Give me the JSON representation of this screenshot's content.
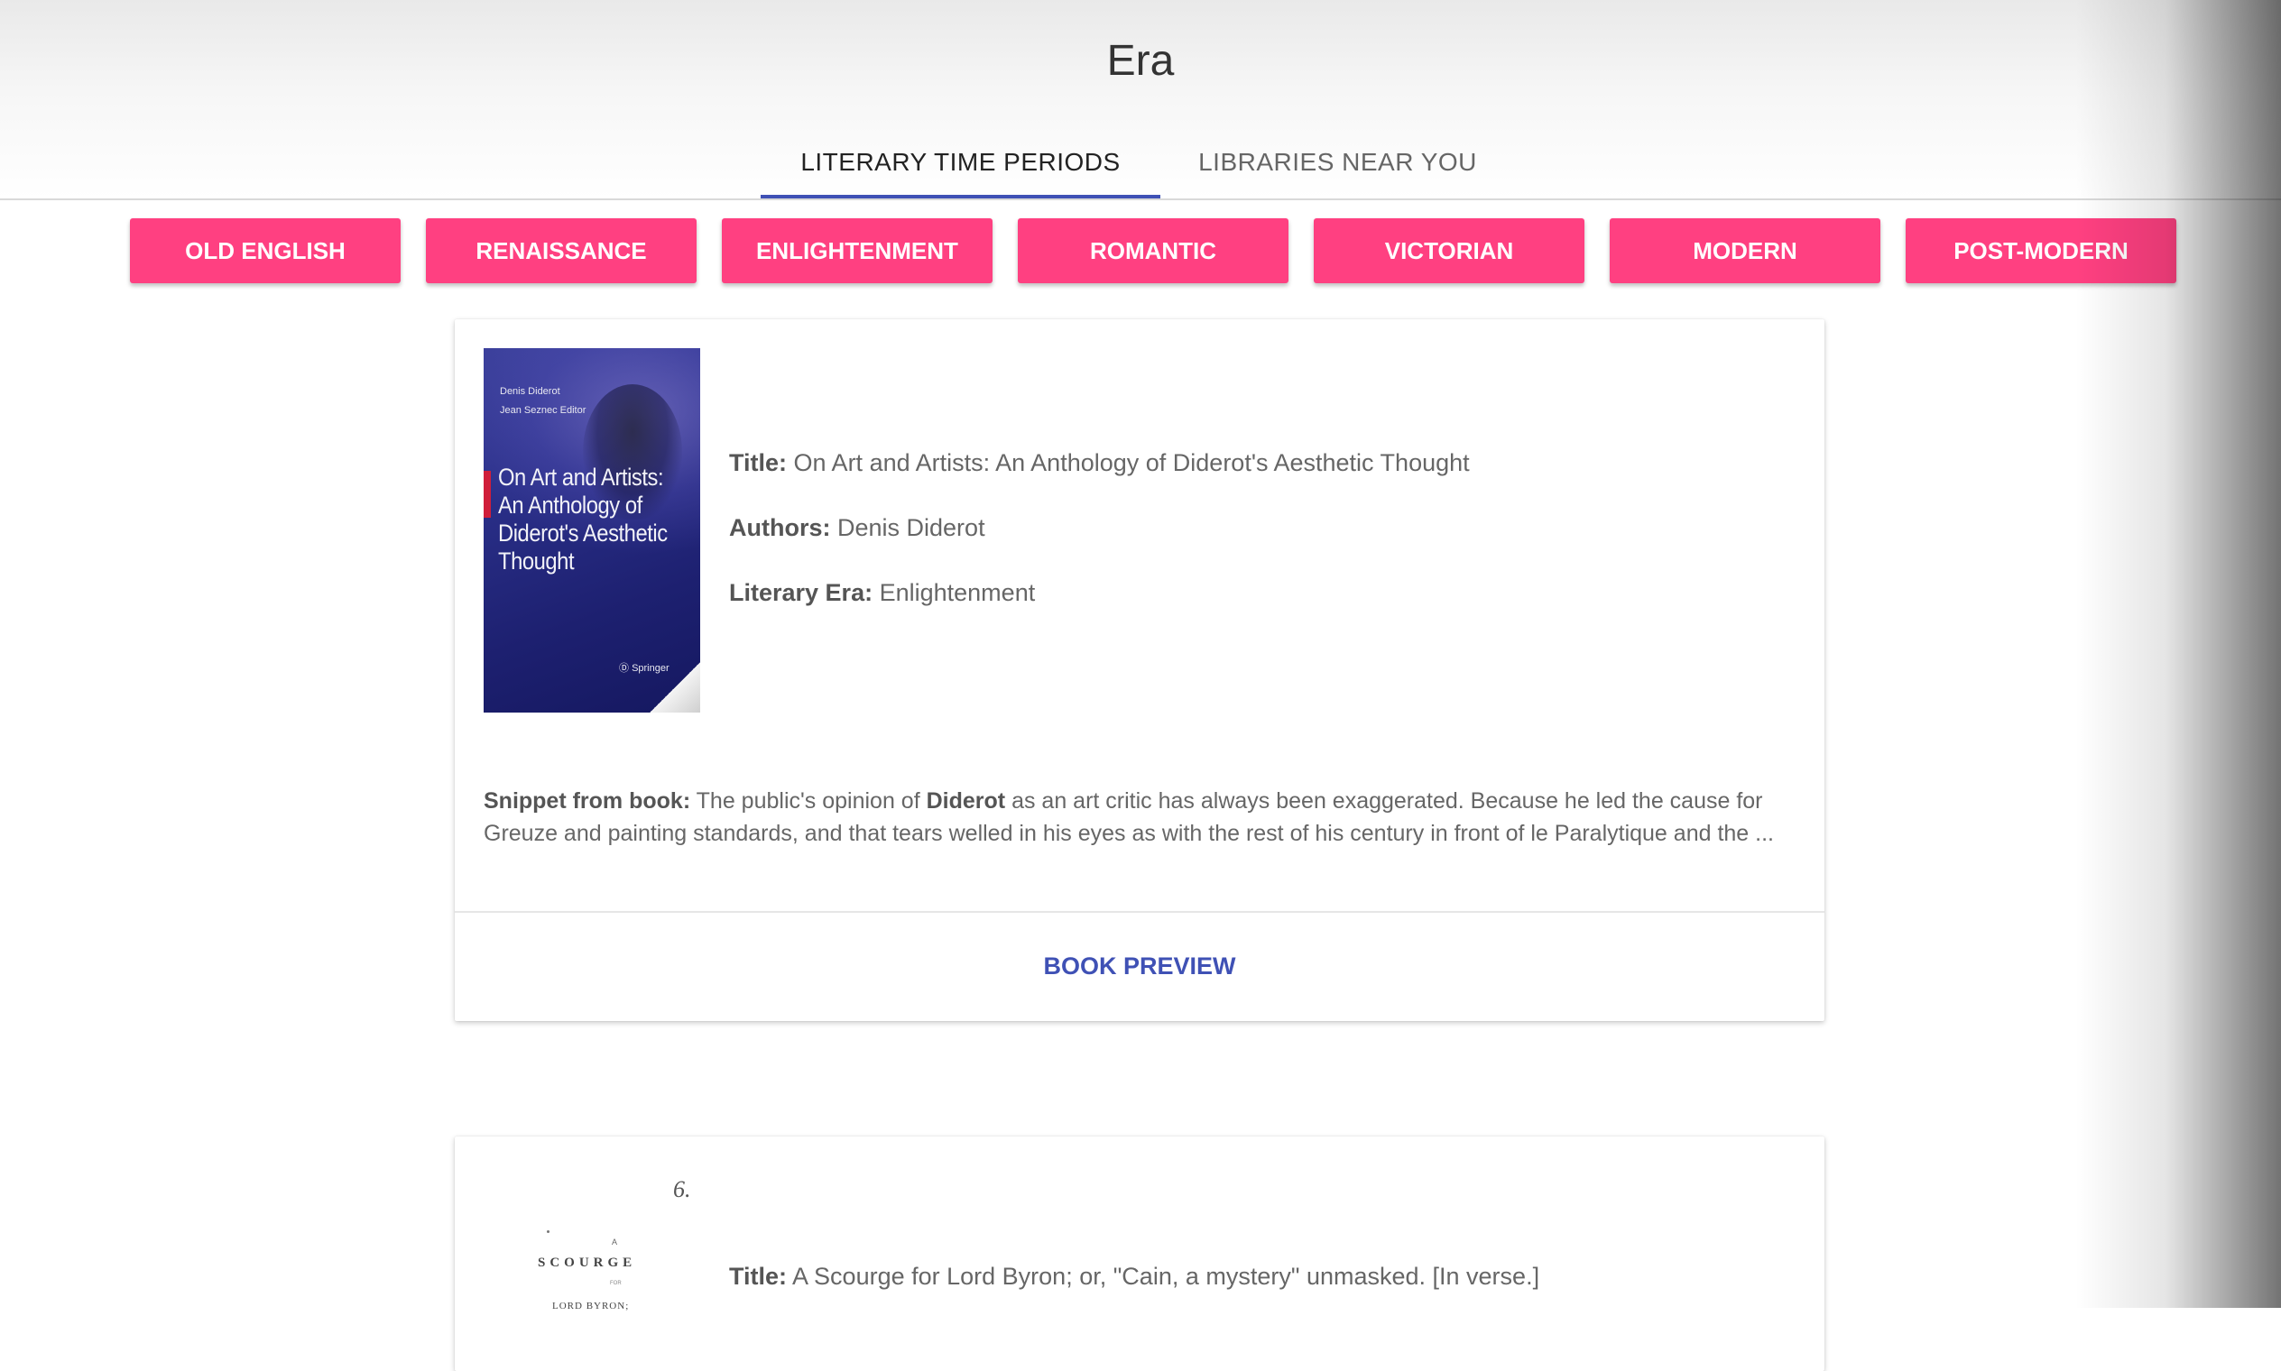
{
  "app": {
    "title": "Era"
  },
  "tabs": [
    {
      "label": "LITERARY TIME PERIODS",
      "active": true
    },
    {
      "label": "LIBRARIES NEAR YOU",
      "active": false
    }
  ],
  "eras": [
    "OLD ENGLISH",
    "RENAISSANCE",
    "ENLIGHTENMENT",
    "ROMANTIC",
    "VICTORIAN",
    "MODERN",
    "POST-MODERN"
  ],
  "colors": {
    "accent": "#ff4081",
    "primary": "#3f51b5"
  },
  "labels": {
    "title": "Title:",
    "authors": "Authors:",
    "era": "Literary Era:",
    "snippet": "Snippet from book:"
  },
  "books": [
    {
      "title": "On Art and Artists: An Anthology of Diderot's Aesthetic Thought",
      "authors": "Denis Diderot",
      "era": "Enlightenment",
      "snippet_before": "The public's opinion of",
      "snippet_bold": "Diderot",
      "snippet_after": "as an art critic has always been exaggerated. Because he led the cause for Greuze and painting standards, and that tears welled in his eyes as with the rest of his century in front of le Paralytique and the ...",
      "preview_label": "BOOK PREVIEW",
      "cover": {
        "editor_line_1": "Denis Diderot",
        "editor_line_2": "Jean Seznec  Editor",
        "title": "On Art and Artists: An Anthology of Diderot's Aesthetic Thought",
        "publisher": "Springer"
      }
    },
    {
      "title": "A Scourge for Lord Byron; or, \"Cain, a mystery\" unmasked. [In verse.]",
      "cover": {
        "mark": "6.",
        "small": "A",
        "scourge": "SCOURGE",
        "for": "FOR",
        "lord": "LORD BYRON;"
      }
    }
  ]
}
